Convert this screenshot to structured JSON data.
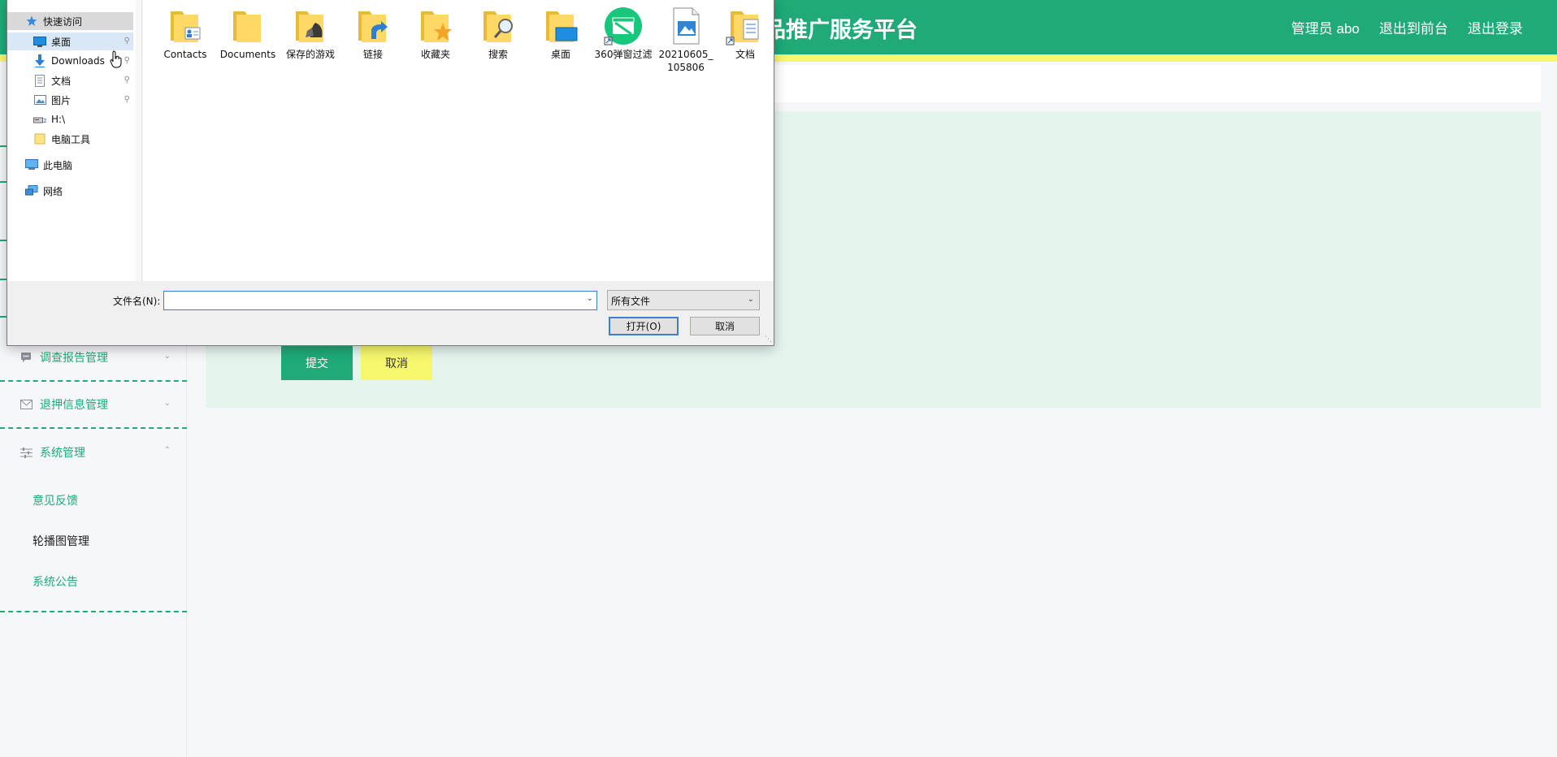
{
  "app": {
    "title": "品推广服务平台",
    "links": [
      "管理员 abo",
      "退出到前台",
      "退出登录"
    ]
  },
  "form": {
    "submit_label": "提交",
    "cancel_label": "取消"
  },
  "sidebar": {
    "groups": [
      {
        "label": "调查报告管理",
        "icon": "chat-icon",
        "expanded": false
      },
      {
        "label": "退押信息管理",
        "icon": "mail-icon",
        "expanded": false
      },
      {
        "label": "系统管理",
        "icon": "sliders-icon",
        "expanded": true
      }
    ],
    "sub_items": [
      {
        "label": "意见反馈",
        "active": false
      },
      {
        "label": "轮播图管理",
        "active": true
      },
      {
        "label": "系统公告",
        "active": false
      }
    ]
  },
  "dialog": {
    "nav": {
      "quick_access": "快速访问",
      "items": [
        {
          "label": "桌面",
          "icon": "desktop-icon",
          "pinned": true
        },
        {
          "label": "Downloads",
          "icon": "download-icon",
          "pinned": true
        },
        {
          "label": "文档",
          "icon": "document-icon",
          "pinned": true
        },
        {
          "label": "图片",
          "icon": "picture-icon",
          "pinned": true
        },
        {
          "label": "H:\\",
          "icon": "drive-icon",
          "pinned": false
        },
        {
          "label": "电脑工具",
          "icon": "folder-icon",
          "pinned": false
        }
      ],
      "this_pc": "此电脑",
      "network": "网络"
    },
    "files": [
      {
        "label": "Contacts",
        "icon": "contacts-folder-icon"
      },
      {
        "label": "Documents",
        "icon": "folder-icon"
      },
      {
        "label": "保存的游戏",
        "icon": "saved-games-folder-icon"
      },
      {
        "label": "链接",
        "icon": "links-folder-icon"
      },
      {
        "label": "收藏夹",
        "icon": "favorites-folder-icon"
      },
      {
        "label": "搜索",
        "icon": "search-folder-icon"
      },
      {
        "label": "桌面",
        "icon": "desktop-folder-icon"
      },
      {
        "label": "360弹窗过滤",
        "icon": "popup-filter-shortcut-icon"
      },
      {
        "label": "20210605_105806",
        "icon": "image-file-icon"
      },
      {
        "label": "文档",
        "icon": "documents-shortcut-icon"
      }
    ],
    "filename_label": "文件名(N):",
    "filename_value": "",
    "filetype_value": "所有文件",
    "open_label": "打开(O)",
    "cancel_label": "取消"
  },
  "colors": {
    "brand": "#1faa78",
    "accent_yellow": "#f7f76e",
    "form_bg": "#e4f5ee"
  }
}
